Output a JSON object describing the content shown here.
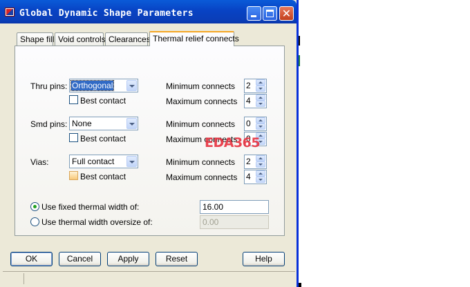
{
  "window": {
    "title": "Global Dynamic Shape Parameters"
  },
  "tabs": [
    {
      "label": "Shape fill"
    },
    {
      "label": "Void controls"
    },
    {
      "label": "Clearances"
    },
    {
      "label": "Thermal relief connects",
      "active": true
    }
  ],
  "thru_pins": {
    "label": "Thru pins:",
    "value": "Orthogonal",
    "best_contact": "Best contact",
    "min_label": "Minimum connects",
    "min": "2",
    "max_label": "Maximum connects",
    "max": "4"
  },
  "smd_pins": {
    "label": "Smd pins:",
    "value": "None",
    "best_contact": "Best contact",
    "min_label": "Minimum connects",
    "min": "0",
    "max_label": "Maximum connects",
    "max": "0"
  },
  "vias": {
    "label": "Vias:",
    "value": "Full contact",
    "best_contact": "Best contact",
    "min_label": "Minimum connects",
    "min": "2",
    "max_label": "Maximum connects",
    "max": "4"
  },
  "thermal_width": {
    "fixed_label": "Use fixed thermal width of:",
    "fixed_value": "16.00",
    "oversize_label": "Use thermal width oversize of:",
    "oversize_value": "0.00"
  },
  "buttons": {
    "ok": "OK",
    "cancel": "Cancel",
    "apply": "Apply",
    "reset": "Reset",
    "help": "Help"
  },
  "watermark": "EDA365",
  "colors": {
    "titlebar": "#0a4fd0",
    "active_tab_accent": "#f5a623",
    "watermark": "#e8313f"
  }
}
